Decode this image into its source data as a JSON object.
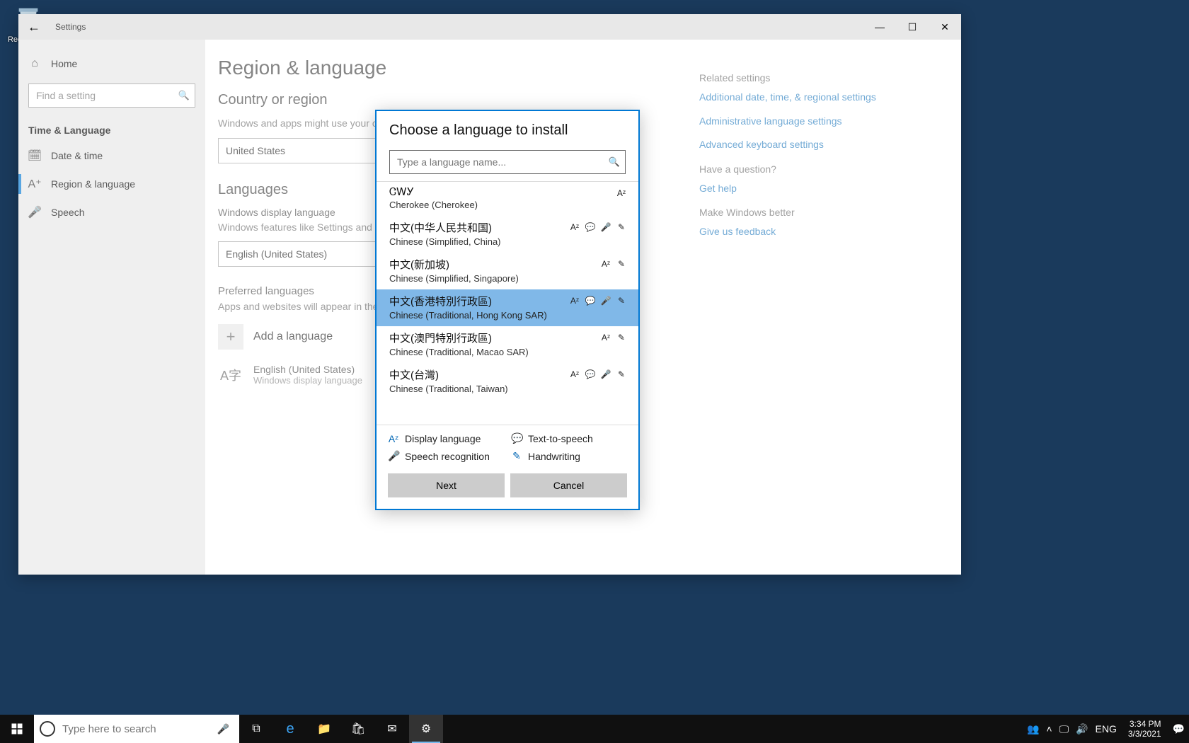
{
  "desktop": {
    "recycle_bin": "Recycle Bin"
  },
  "window": {
    "title": "Settings",
    "home": "Home",
    "search_placeholder": "Find a setting",
    "group": "Time & Language",
    "nav": {
      "datetime": "Date & time",
      "region": "Region & language",
      "speech": "Speech"
    }
  },
  "page": {
    "title": "Region & language",
    "country_h": "Country or region",
    "country_desc": "Windows and apps might use your country or region to give you local content",
    "country_value": "United States",
    "languages_h": "Languages",
    "display_label": "Windows display language",
    "display_desc": "Windows features like Settings and File Explorer will appear in this language.",
    "display_value": "English (United States)",
    "preferred_h": "Preferred languages",
    "preferred_desc": "Apps and websites will appear in the first language in the list that they support.",
    "add_lang": "Add a language",
    "installed": {
      "name": "English (United States)",
      "sub": "Windows display language"
    }
  },
  "related": {
    "header": "Related settings",
    "link1": "Additional date, time, & regional settings",
    "link2": "Administrative language settings",
    "link3": "Advanced keyboard settings",
    "question_h": "Have a question?",
    "help": "Get help",
    "better_h": "Make Windows better",
    "feedback": "Give us feedback"
  },
  "modal": {
    "title": "Choose a language to install",
    "search_placeholder": "Type a language name...",
    "languages": [
      {
        "native": "ᏣᎳᎩ",
        "english": "Cherokee (Cherokee)",
        "features": [
          "display"
        ]
      },
      {
        "native": "中文(中华人民共和国)",
        "english": "Chinese (Simplified, China)",
        "features": [
          "display",
          "tts",
          "speech",
          "hand"
        ]
      },
      {
        "native": "中文(新加坡)",
        "english": "Chinese (Simplified, Singapore)",
        "features": [
          "display",
          "hand"
        ]
      },
      {
        "native": "中文(香港特別行政區)",
        "english": "Chinese (Traditional, Hong Kong SAR)",
        "features": [
          "display",
          "tts",
          "speech",
          "hand"
        ],
        "selected": true
      },
      {
        "native": "中文(澳門特別行政區)",
        "english": "Chinese (Traditional, Macao SAR)",
        "features": [
          "display",
          "hand"
        ]
      },
      {
        "native": "中文(台灣)",
        "english": "Chinese (Traditional, Taiwan)",
        "features": [
          "display",
          "tts",
          "speech",
          "hand"
        ]
      }
    ],
    "legend": {
      "display": "Display language",
      "tts": "Text-to-speech",
      "speech": "Speech recognition",
      "hand": "Handwriting"
    },
    "next": "Next",
    "cancel": "Cancel"
  },
  "taskbar": {
    "search_placeholder": "Type here to search",
    "lang": "ENG",
    "time": "3:34 PM",
    "date": "3/3/2021"
  }
}
